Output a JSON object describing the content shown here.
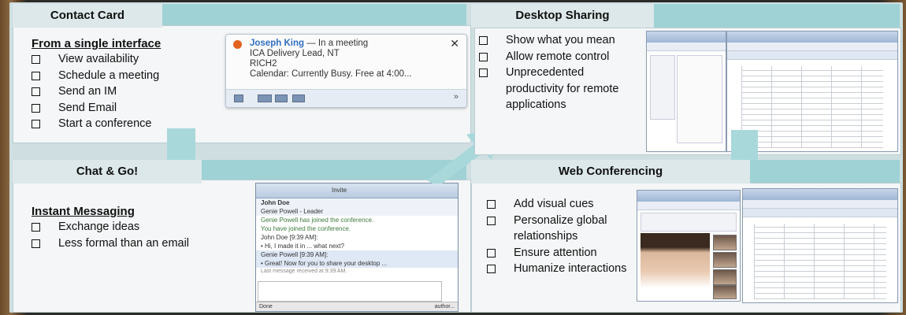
{
  "contact_card": {
    "title": "Contact Card",
    "heading": "From a single interface",
    "items": [
      "View availability",
      "Schedule a meeting",
      "Send an IM",
      "Send Email",
      "Start a conference"
    ],
    "popup": {
      "name": "Joseph King",
      "presence": " — In a meeting",
      "line2": "ICA Delivery Lead, NT",
      "line3": "RICH2",
      "line4": "Calendar: Currently Busy. Free at 4:00...",
      "close": "✕",
      "expand": "»"
    }
  },
  "chat_go": {
    "title": "Chat & Go!",
    "heading": "Instant Messaging",
    "items": [
      "Exchange ideas",
      "Less formal than an email"
    ],
    "window": {
      "toolbar_invite": "Invite",
      "participants": [
        "John Doe",
        "Genie Powell - Leader"
      ],
      "lines": [
        "Genie Powell has joined the conference.",
        "You have joined the conference.",
        "John Doe [9:39 AM]:",
        "• Hi, I made it in ... what next?",
        "Genie Powell [9:39 AM]:",
        "• Great! Now for you to share your desktop ...",
        "Last message received at 9:39 AM."
      ],
      "status_left": "Done",
      "status_right": "author..."
    }
  },
  "desktop_sharing": {
    "title": "Desktop Sharing",
    "items": [
      "Show what you mean",
      "Allow remote control",
      "Unprecedented productivity for remote applications"
    ]
  },
  "web_conferencing": {
    "title": "Web Conferencing",
    "items": [
      "Add visual cues",
      "Personalize global relationships",
      "Ensure attention",
      "Humanize interactions"
    ]
  },
  "colors": {
    "slide_bg": "#cfdfe1",
    "band": "#9fd2d4",
    "panel": "#f4f6f7",
    "tab": "#dde8ea",
    "presence_busy": "#e1621f"
  }
}
